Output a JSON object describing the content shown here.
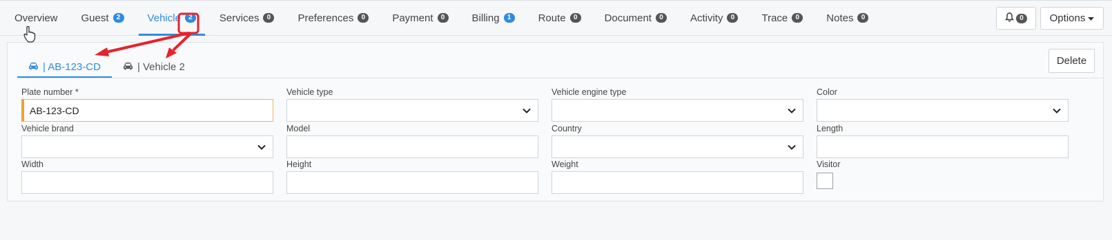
{
  "tabs": [
    {
      "label": "Overview",
      "badge": null
    },
    {
      "label": "Guest",
      "badge": "2",
      "badge_color": "#2f8be0"
    },
    {
      "label": "Vehicle",
      "badge": "2",
      "badge_color": "#2f8be0",
      "active": true
    },
    {
      "label": "Services",
      "badge": "0"
    },
    {
      "label": "Preferences",
      "badge": "0"
    },
    {
      "label": "Payment",
      "badge": "0"
    },
    {
      "label": "Billing",
      "badge": "1",
      "badge_color": "#2f8be0"
    },
    {
      "label": "Route",
      "badge": "0"
    },
    {
      "label": "Document",
      "badge": "0"
    },
    {
      "label": "Activity",
      "badge": "0"
    },
    {
      "label": "Trace",
      "badge": "0"
    },
    {
      "label": "Notes",
      "badge": "0"
    }
  ],
  "notifications": {
    "count": "0",
    "icon": "bell-icon"
  },
  "options": {
    "label": "Options"
  },
  "vehicle_tabs": [
    {
      "label": "| AB-123-CD",
      "icon": "car-icon",
      "active": true
    },
    {
      "label": "| Vehicle 2",
      "icon": "car-icon"
    }
  ],
  "delete_label": "Delete",
  "fields": {
    "plate_number": {
      "label": "Plate number *",
      "value": "AB-123-CD"
    },
    "vehicle_type": {
      "label": "Vehicle type",
      "value": ""
    },
    "vehicle_engine_type": {
      "label": "Vehicle engine type",
      "value": ""
    },
    "color": {
      "label": "Color",
      "value": ""
    },
    "vehicle_brand": {
      "label": "Vehicle brand",
      "value": ""
    },
    "model": {
      "label": "Model",
      "value": ""
    },
    "country": {
      "label": "Country",
      "value": ""
    },
    "length": {
      "label": "Length",
      "value": ""
    },
    "width": {
      "label": "Width",
      "value": ""
    },
    "height": {
      "label": "Height",
      "value": ""
    },
    "weight": {
      "label": "Weight",
      "value": ""
    },
    "visitor": {
      "label": "Visitor",
      "checked": false
    }
  },
  "colors": {
    "accent": "#2f8be0",
    "annotation": "#e8222a",
    "required": "#f0a033"
  }
}
